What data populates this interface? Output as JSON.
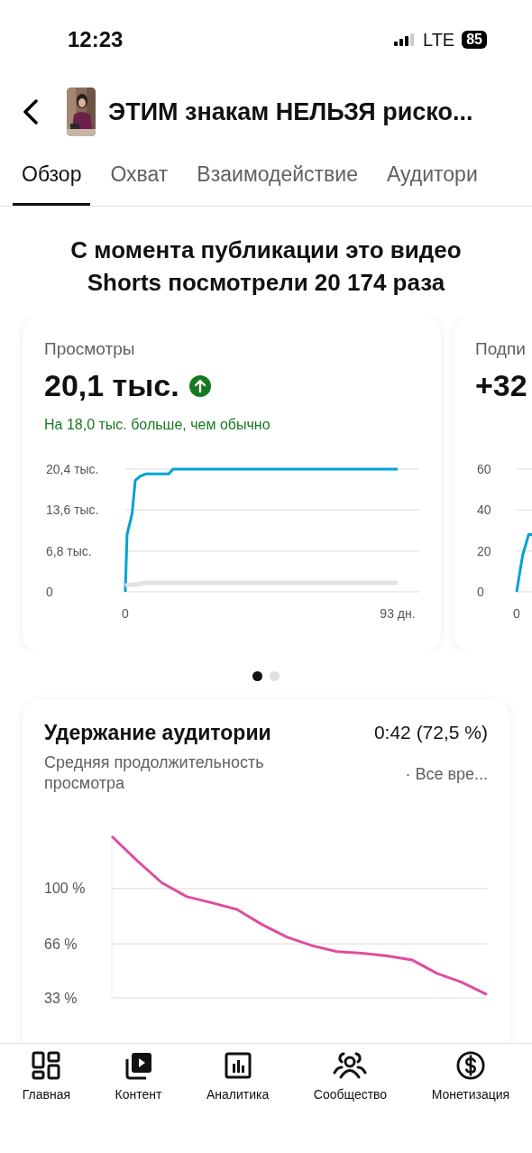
{
  "status_bar": {
    "time": "12:23",
    "network": "LTE",
    "battery": "85"
  },
  "header": {
    "title": "ЭТИМ знакам НЕЛЬЗЯ риско..."
  },
  "tabs": [
    {
      "label": "Обзор",
      "selected": true
    },
    {
      "label": "Охват",
      "selected": false
    },
    {
      "label": "Взаимодействие",
      "selected": false
    },
    {
      "label": "Аудитори",
      "selected": false
    }
  ],
  "headline": "С момента публикации это видео Shorts посмотрели 20 174 раза",
  "metric_cards": [
    {
      "label": "Просмотры",
      "value": "20,1 тыс.",
      "trend_up": true,
      "note": "На 18,0 тыс. больше, чем обычно",
      "chart_data": {
        "type": "line",
        "xlim": [
          0,
          93
        ],
        "ylim": [
          0,
          20.4
        ],
        "xticks": [
          {
            "value": 0,
            "label": "0"
          },
          {
            "value": 93,
            "label": "93 дн."
          }
        ],
        "yticks": [
          {
            "value": 20.4,
            "label": "20,4 тыс."
          },
          {
            "value": 13.6,
            "label": "13,6 тыс."
          },
          {
            "value": 6.8,
            "label": "6,8 тыс."
          },
          {
            "value": 0,
            "label": "0"
          }
        ],
        "x": [
          0,
          0.6,
          2.3,
          3.4,
          5,
          7,
          14.8,
          16.3,
          93
        ],
        "series": [
          {
            "color": "#00a3d4",
            "values": [
              0,
              9.5,
              13,
              18.5,
              19.2,
              19.6,
              19.6,
              20.4,
              20.4
            ]
          },
          {
            "color": "#e3e3e3",
            "values": [
              1,
              1.1,
              1.2,
              1.2,
              1.3,
              1.5,
              1.5,
              1.5,
              1.5
            ]
          }
        ]
      }
    },
    {
      "label": "Подпи",
      "value": "+32",
      "trend_up": false,
      "chart_data": {
        "type": "line",
        "ylim": [
          0,
          60
        ],
        "yticks": [
          {
            "value": 60,
            "label": "60"
          },
          {
            "value": 40,
            "label": "40"
          },
          {
            "value": 20,
            "label": "20"
          },
          {
            "value": 0,
            "label": "0"
          }
        ],
        "categories": [
          null,
          null,
          null,
          null,
          null,
          null,
          null
        ],
        "annotations": [
          "0"
        ],
        "series": [
          {
            "color": "#00a3d4",
            "values": [
              0,
              9,
              18,
              23,
              28,
              28,
              29
            ]
          }
        ]
      }
    }
  ],
  "pager": [
    {
      "selected": true
    },
    {
      "selected": false
    }
  ],
  "retention": {
    "title": "Удержание аудитории",
    "value": "0:42 (72,5 %)",
    "subtitle": "Средняя продолжительность просмотра",
    "period": "· Все вре...",
    "chart_data": {
      "type": "line",
      "ylim": [
        33,
        132
      ],
      "yticks": [
        {
          "value": 100,
          "label": "100 %"
        },
        {
          "value": 66,
          "label": "66 %"
        },
        {
          "value": 33,
          "label": "33 %"
        }
      ],
      "categories": [
        null,
        null,
        null,
        null,
        null,
        null,
        null,
        null,
        null,
        null,
        null,
        null,
        null,
        null,
        null,
        null
      ],
      "series": [
        {
          "color": "#de4d9e",
          "values": [
            132,
            117.3,
            103.5,
            95,
            91.3,
            87.2,
            78,
            70.2,
            65,
            61.4,
            60.3,
            58.7,
            56.3,
            48,
            42.5,
            35
          ]
        }
      ]
    }
  },
  "nav": [
    {
      "label": "Главная"
    },
    {
      "label": "Контент"
    },
    {
      "label": "Аналитика"
    },
    {
      "label": "Сообщество"
    },
    {
      "label": "Монетизация"
    }
  ]
}
